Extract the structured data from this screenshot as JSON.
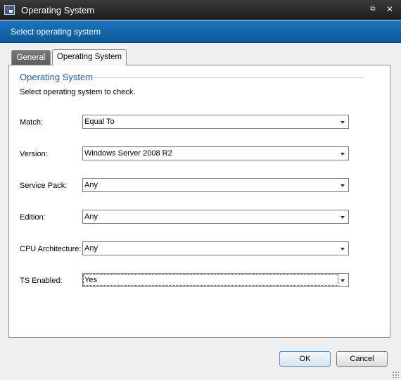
{
  "window": {
    "title": "Operating System",
    "restore_glyph": "⧉",
    "close_glyph": "✕",
    "icon": "app-icon"
  },
  "header": {
    "text": "Select operating system"
  },
  "tabs": [
    {
      "label": "General",
      "selected": false
    },
    {
      "label": "Operating System",
      "selected": true
    }
  ],
  "section": {
    "title": "Operating System",
    "description": "Select operating system to check."
  },
  "fields": [
    {
      "label": "Match:",
      "value": "Equal To"
    },
    {
      "label": "Version:",
      "value": "Windows Server 2008 R2"
    },
    {
      "label": "Service Pack:",
      "value": "Any"
    },
    {
      "label": "Edition:",
      "value": "Any"
    },
    {
      "label": "CPU Architecture:",
      "value": "Any"
    },
    {
      "label": "TS Enabled:",
      "value": "Yes"
    }
  ],
  "buttons": {
    "ok": "OK",
    "cancel": "Cancel"
  },
  "colors": {
    "header_blue": "#0b5a9c",
    "section_title": "#1f5bb0",
    "title_bar": "#2a2a2a"
  }
}
